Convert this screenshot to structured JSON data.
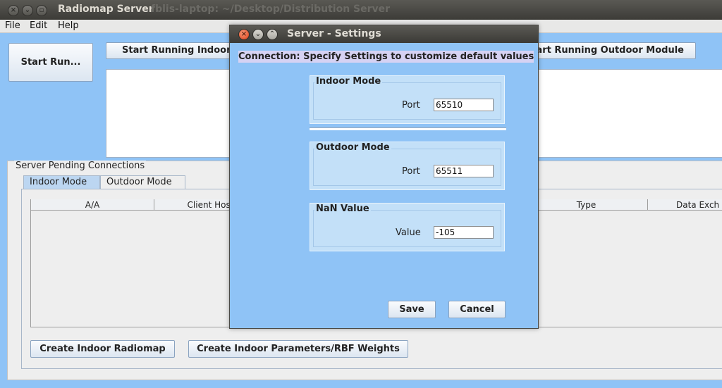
{
  "main_window": {
    "title": "Radiomap Server",
    "background_title": "fblis-laptop: ~/Desktop/Distribution Server",
    "menu": [
      "File",
      "Edit",
      "Help"
    ],
    "start_run_label": "Start Run...",
    "start_indoor_label": "Start Running Indoor Module",
    "start_outdoor_label": "Start Running Outdoor Module",
    "pending_label": "Server Pending Connections",
    "tabs": [
      "Indoor Mode",
      "Outdoor Mode"
    ],
    "columns": [
      "A/A",
      "Client Host",
      "Type",
      "Data Exch"
    ],
    "create_radiomap_label": "Create Indoor Radiomap",
    "create_params_label": "Create Indoor Parameters/RBF Weights"
  },
  "dialog": {
    "title": "Server - Settings",
    "connection_label": "Connection: Specify Settings to customize default values",
    "indoor": {
      "title": "Indoor Mode",
      "port_label": "Port",
      "port_value": "65510"
    },
    "outdoor": {
      "title": "Outdoor Mode",
      "port_label": "Port",
      "port_value": "65511"
    },
    "nan": {
      "title": "NaN Value",
      "value_label": "Value",
      "value": "-105"
    },
    "save_label": "Save",
    "cancel_label": "Cancel"
  },
  "colors": {
    "background": "#8fc3f6",
    "titlebar": "#3c3b37",
    "close_button": "#e8623d",
    "group_background": "#c3e0f8",
    "highlight_label": "#d6d2f3"
  }
}
